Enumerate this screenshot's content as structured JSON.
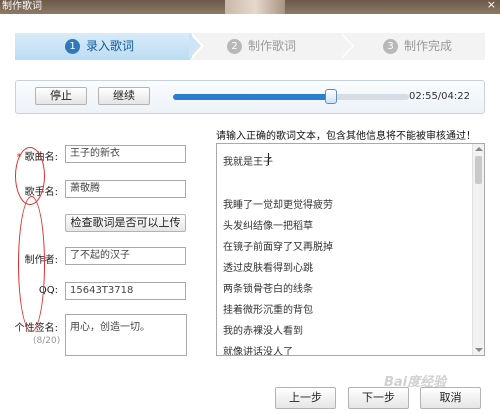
{
  "window": {
    "title": "制作歌词",
    "close": "×"
  },
  "steps": [
    {
      "num": "1",
      "label": "录入歌词"
    },
    {
      "num": "2",
      "label": "制作歌词"
    },
    {
      "num": "3",
      "label": "制作完成"
    }
  ],
  "player": {
    "stop_label": "停止",
    "continue_label": "继续",
    "time": "02:55/04:22",
    "progress": 0.67
  },
  "form": {
    "song_name": {
      "label": "歌曲名:",
      "value": "王子的新衣"
    },
    "singer": {
      "label": "歌手名:",
      "value": "萧敬腾"
    },
    "check_button": "检查歌词是否可以上传",
    "producer": {
      "label": "制作者:",
      "value": "了不起的汉子"
    },
    "qq": {
      "label": "QQ:",
      "value": "15643T3718"
    },
    "signature": {
      "label": "个性签名:",
      "value": "用心，创造一切。",
      "counter": "(8/20)"
    }
  },
  "lyrics": {
    "instruction": "请输入正确的歌词文本，包含其他信息将不能被审核通过！",
    "lines": [
      "我就是王子",
      "",
      "我睡了一觉却更觉得疲劳",
      "头发纠结像一把稻草",
      "在镜子前面穿了又再脱掉",
      "透过皮肤看得到心跳",
      "两条锁骨苍白的线条",
      "挂着微形沉重的背包",
      "我的赤裸没人看到",
      "就像讲话没人了"
    ]
  },
  "footer": {
    "prev": "上一步",
    "next": "下一步",
    "cancel": "取消"
  },
  "watermark": "Bai度经验"
}
